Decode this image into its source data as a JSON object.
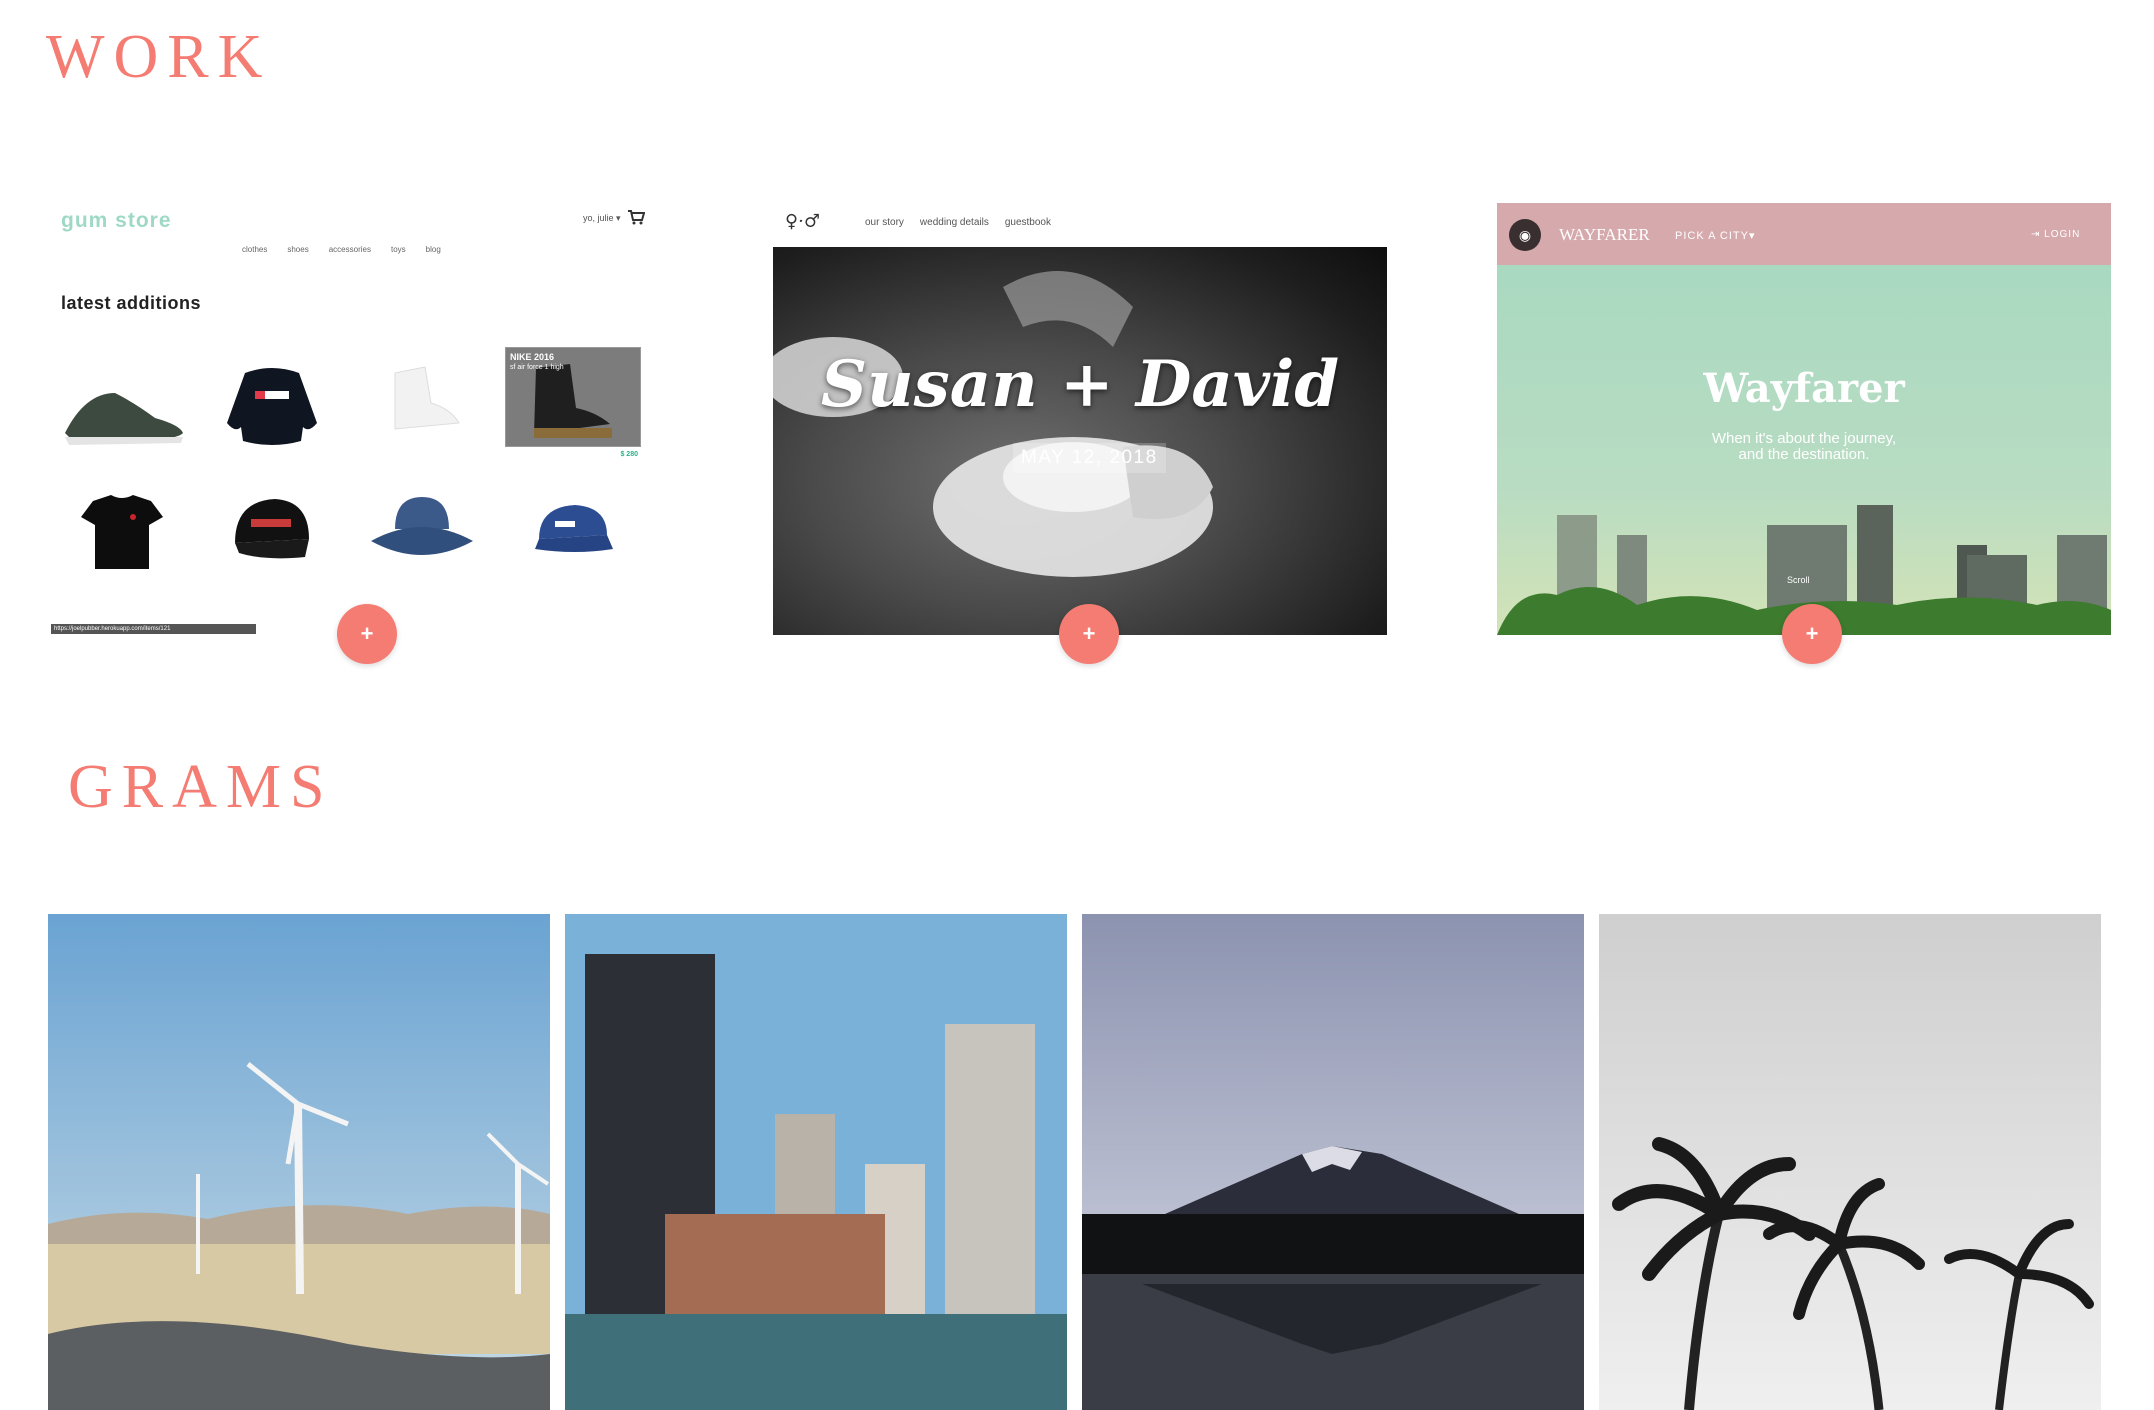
{
  "sections": {
    "work_title": "WORK",
    "grams_title": "GRAMS"
  },
  "work": {
    "plus_label": "+",
    "gum_store": {
      "logo": "gum store",
      "user": "yo, julie",
      "nav": [
        "clothes",
        "shoes",
        "accessories",
        "toys",
        "blog"
      ],
      "heading": "latest additions",
      "hover_title": "NIKE 2016",
      "hover_sub": "sf air force 1 high",
      "hover_price": "$ 280",
      "status_url": "https://joelpubber.herokuapp.com/items/121"
    },
    "wedding": {
      "nav": [
        "our story",
        "wedding details",
        "guestbook"
      ],
      "title": "Susan + David",
      "date": "MAY 12, 2018"
    },
    "wayfarer": {
      "brand": "WAYFARER",
      "city_menu": "PICK A CITY",
      "login": "LOGIN",
      "title": "Wayfarer",
      "subtitle_1": "When it's about the journey,",
      "subtitle_2": "and the destination.",
      "scroll": "Scroll"
    }
  },
  "colors": {
    "accent": "#f47c72",
    "gum_logo": "#9fd9c6",
    "wayfarer_bar": "#d6aaad"
  }
}
